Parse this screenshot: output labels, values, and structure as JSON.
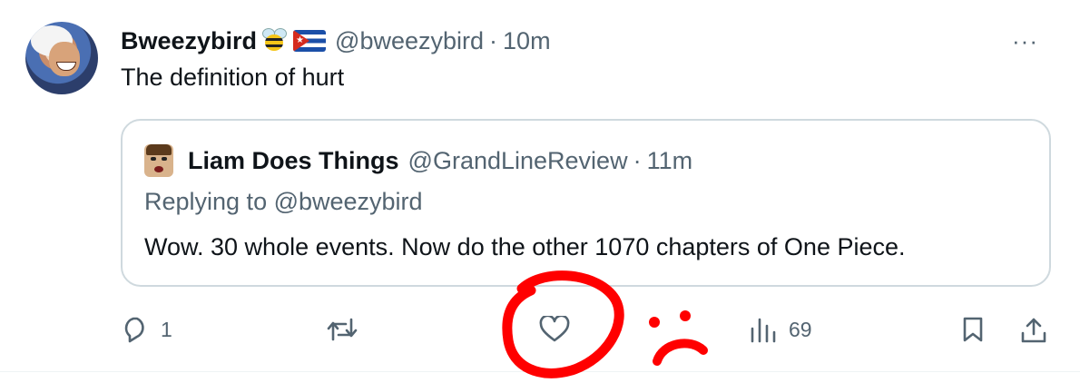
{
  "tweet": {
    "author_name": "Bweezybird",
    "author_handle": "@bweezybird",
    "time": "10m",
    "separator": "·",
    "text": "The definition of hurt",
    "more_label": "···"
  },
  "quoted": {
    "author_name": "Liam Does Things",
    "author_handle": "@GrandLineReview",
    "time": "11m",
    "separator": "·",
    "replying_to": "Replying to @bweezybird",
    "text": "Wow. 30 whole events. Now do the other 1070 chapters of One Piece."
  },
  "actions": {
    "reply_count": "1",
    "retweet_count": "",
    "like_count": "",
    "views_count": "69"
  },
  "icons": {
    "reply": "reply-icon",
    "retweet": "retweet-icon",
    "like": "heart-icon",
    "views": "views-icon",
    "bookmark": "bookmark-icon",
    "share": "share-icon",
    "more": "more-icon"
  },
  "colors": {
    "text_primary": "#0f1419",
    "text_secondary": "#536471",
    "border": "#cfd9de",
    "annotation_red": "#ff0000"
  }
}
